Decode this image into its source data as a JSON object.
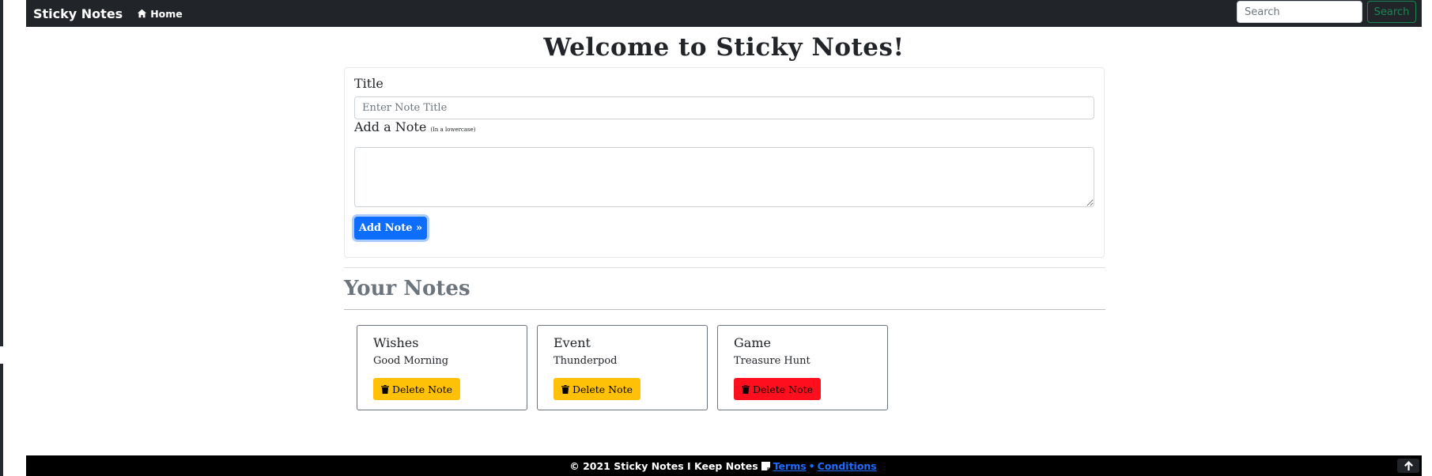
{
  "navbar": {
    "brand": "Sticky Notes",
    "home_label": "Home",
    "search_placeholder": "Search",
    "search_button": "Search"
  },
  "main": {
    "heading": "Welcome to Sticky Notes!",
    "form": {
      "title_label": "Title",
      "title_placeholder": "Enter Note Title",
      "note_label": "Add a Note",
      "note_hint": "(In a lowercase)",
      "note_value": "",
      "add_button": "Add Note »"
    },
    "notes_heading": "Your Notes",
    "notes": [
      {
        "title": "Wishes",
        "text": "Good Morning",
        "delete_label": "Delete Note",
        "button_color": "#ffc107"
      },
      {
        "title": "Event",
        "text": "Thunderpod",
        "delete_label": "Delete Note",
        "button_color": "#ffc107"
      },
      {
        "title": "Game",
        "text": "Treasure Hunt",
        "delete_label": "Delete Note",
        "button_color": "#ff0e1d"
      }
    ]
  },
  "footer": {
    "text": "© 2021 Sticky Notes I Keep Notes",
    "terms": "Terms",
    "separator": "•",
    "conditions": "Conditions"
  },
  "colors": {
    "navbar_bg": "#212529",
    "primary": "#0d6efd",
    "success": "#198754",
    "warning": "#ffc107",
    "danger": "#ff0e1d",
    "footer_bg": "#000000"
  }
}
